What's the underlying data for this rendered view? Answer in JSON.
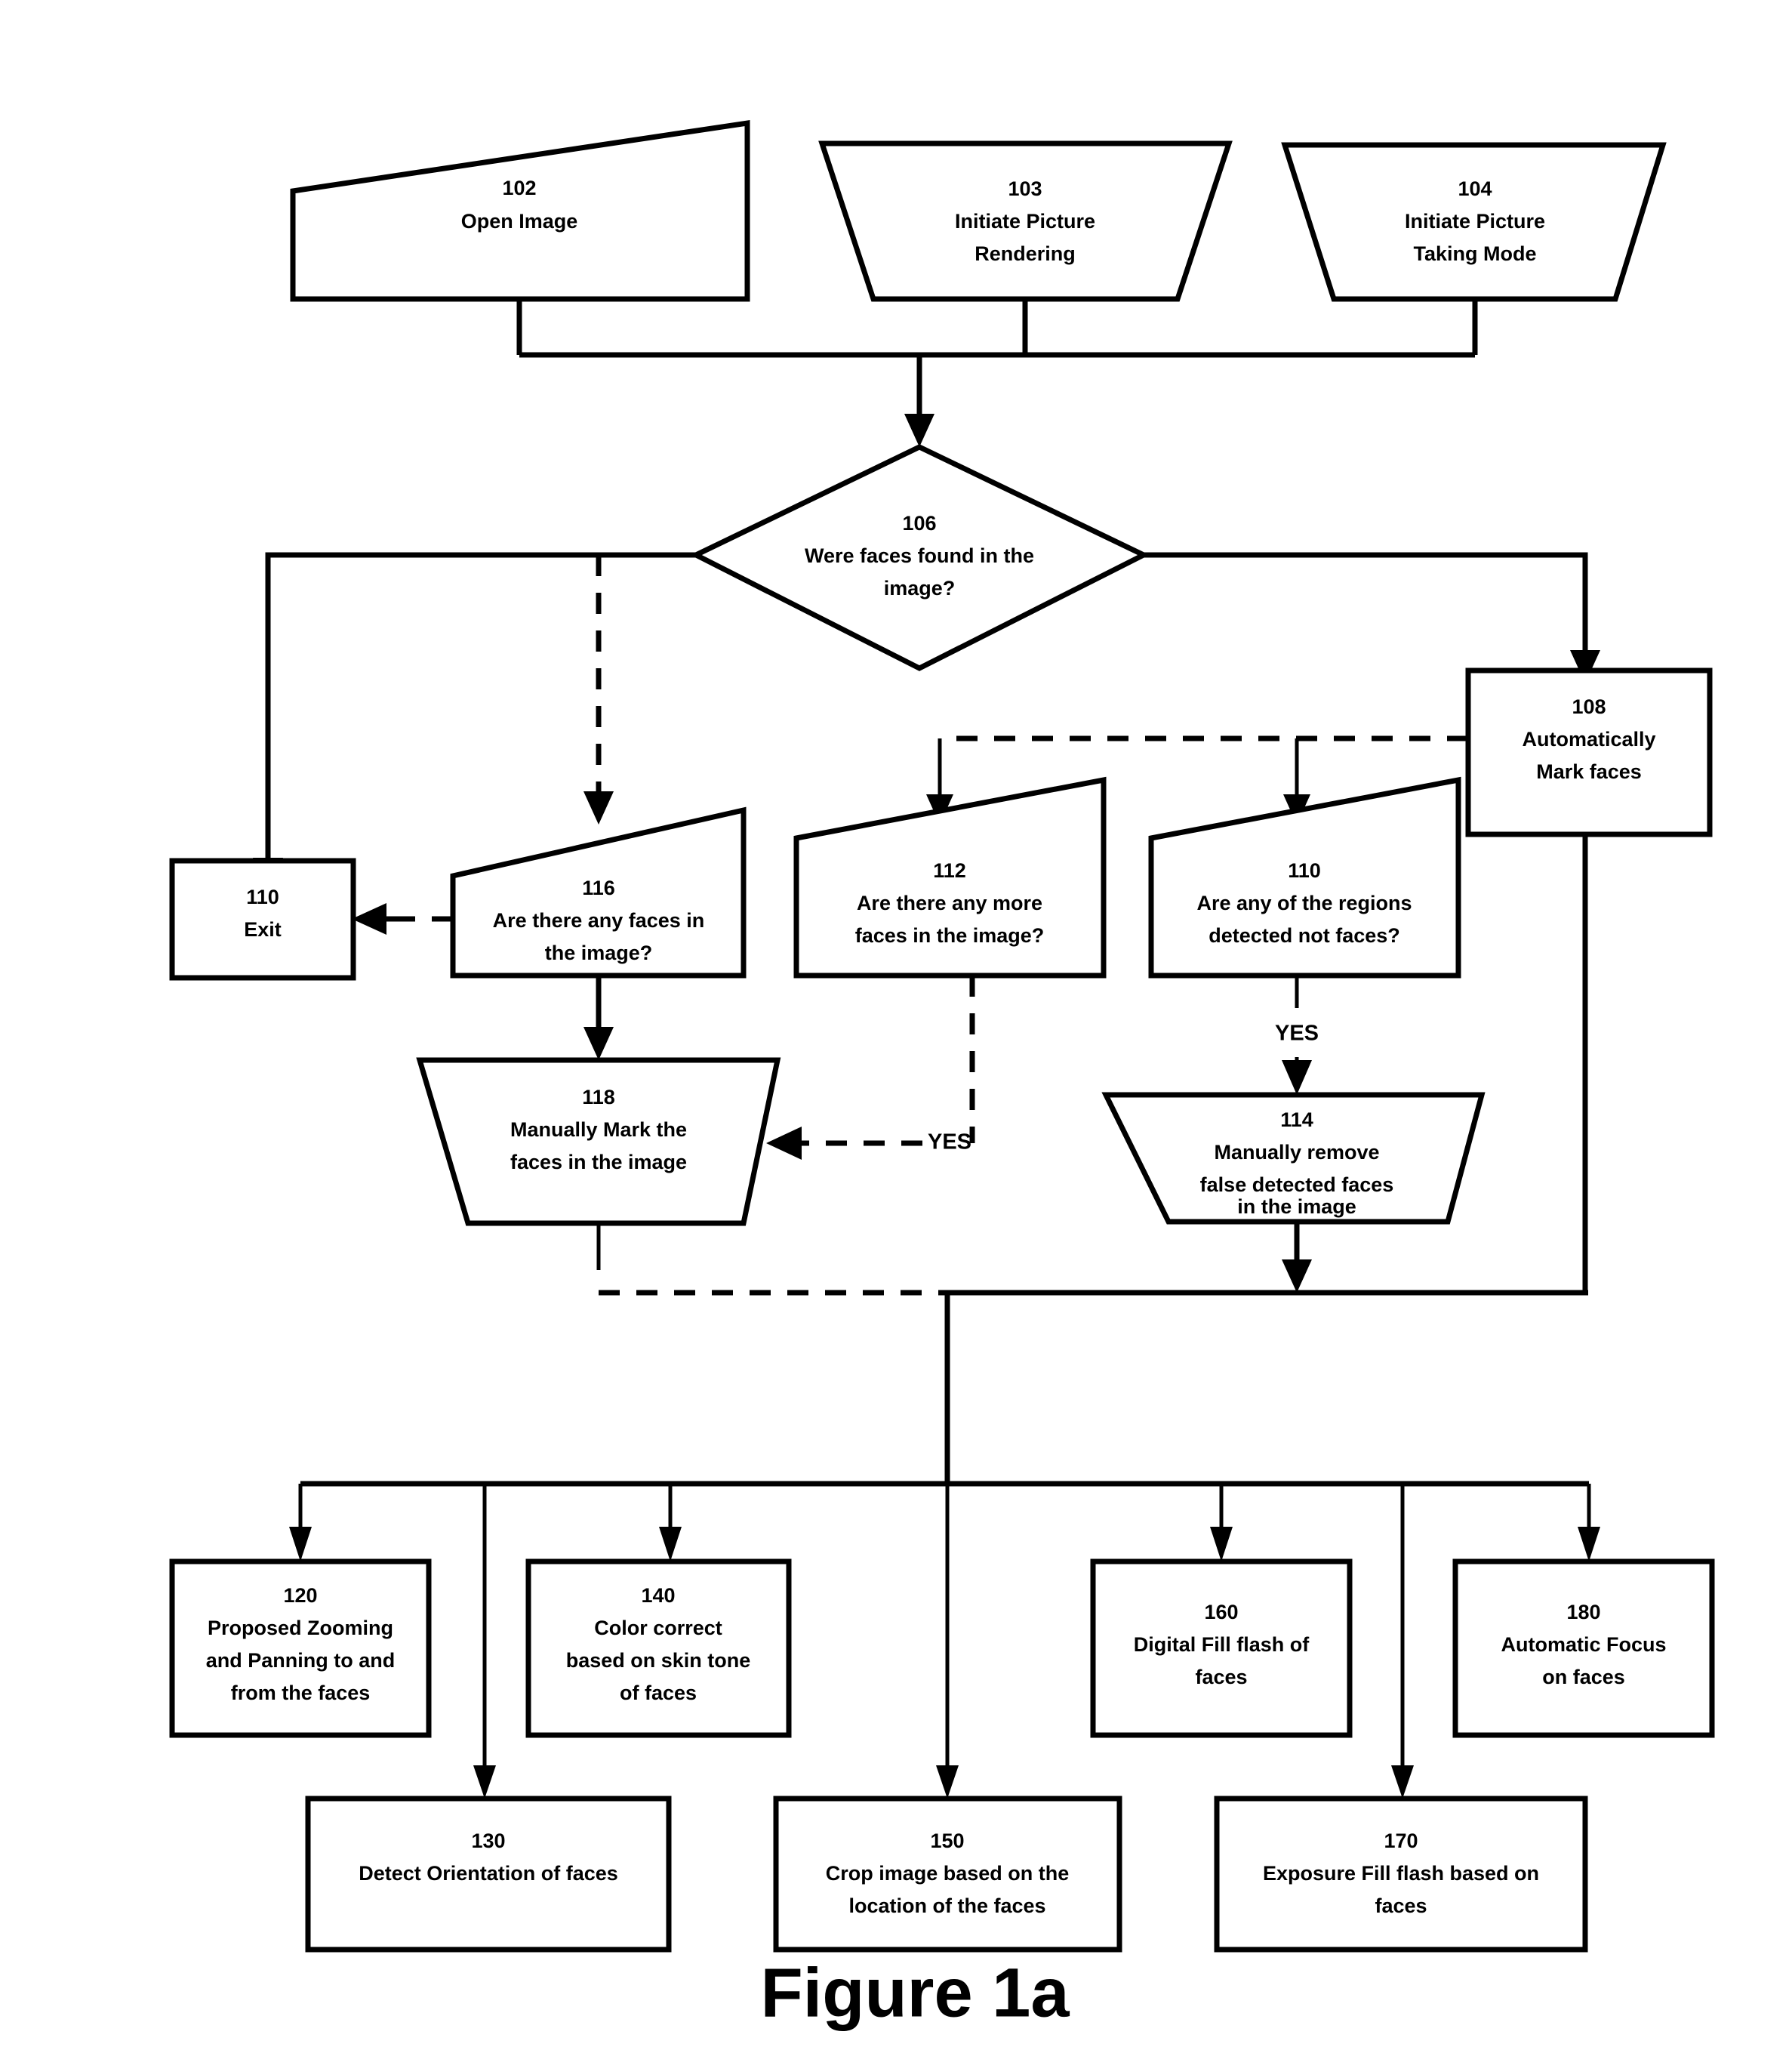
{
  "figure": {
    "caption": "Figure 1a"
  },
  "nodes": {
    "n102": {
      "id": "102",
      "lines": [
        "Open Image"
      ]
    },
    "n103": {
      "id": "103",
      "lines": [
        "Initiate Picture",
        "Rendering"
      ]
    },
    "n104": {
      "id": "104",
      "lines": [
        "Initiate Picture",
        "Taking Mode"
      ]
    },
    "n106": {
      "id": "106",
      "lines": [
        "Were faces found in the",
        "image?"
      ]
    },
    "n108": {
      "id": "108",
      "lines": [
        "Automatically",
        "Mark faces"
      ]
    },
    "n110exit": {
      "id": "110",
      "lines": [
        "Exit"
      ]
    },
    "n116": {
      "id": "116",
      "lines": [
        "Are there any faces in",
        "the image?"
      ]
    },
    "n112": {
      "id": "112",
      "lines": [
        "Are there any more",
        "faces in the image?"
      ]
    },
    "n110reg": {
      "id": "110",
      "lines": [
        "Are any of the regions",
        "detected not faces?"
      ]
    },
    "n118": {
      "id": "118",
      "lines": [
        "Manually Mark the",
        "faces in the image"
      ]
    },
    "n114": {
      "id": "114",
      "lines": [
        "Manually remove",
        "false detected faces",
        "in the image"
      ]
    },
    "n120": {
      "id": "120",
      "lines": [
        "Proposed Zooming",
        "and Panning to and",
        "from the faces"
      ]
    },
    "n140": {
      "id": "140",
      "lines": [
        "Color correct",
        "based on skin tone",
        "of faces"
      ]
    },
    "n160": {
      "id": "160",
      "lines": [
        "Digital Fill flash of",
        "faces"
      ]
    },
    "n180": {
      "id": "180",
      "lines": [
        "Automatic Focus",
        "on faces"
      ]
    },
    "n130": {
      "id": "130",
      "lines": [
        "Detect Orientation of faces"
      ]
    },
    "n150": {
      "id": "150",
      "lines": [
        "Crop image based on the",
        "location of the faces"
      ]
    },
    "n170": {
      "id": "170",
      "lines": [
        "Exposure Fill flash based on",
        "faces"
      ]
    }
  },
  "edge_labels": {
    "yes_110_to_114": "YES",
    "yes_112_to_118": "YES"
  },
  "colors": {
    "stroke": "#000000",
    "fill": "#ffffff"
  }
}
